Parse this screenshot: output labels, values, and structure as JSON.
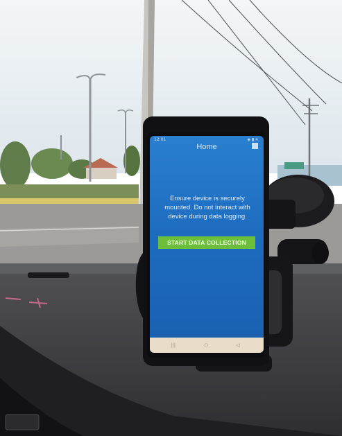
{
  "phone": {
    "status_time": "12:01",
    "status_icons": "◈ ▮ 4",
    "screen_title": "Home",
    "message": "Ensure device is securely mounted. Do not interact with device during data logging.",
    "start_button_label": "START DATA COLLECTION",
    "nav_back": "◁",
    "nav_home": "○",
    "nav_recent": "|||",
    "menu_icon": "square-menu-icon"
  },
  "colors": {
    "screen_blue": "#1d6cc0",
    "button_green": "#6cbf3a",
    "sky": "#e7eef3",
    "dashboard": "#3a3a3d"
  }
}
